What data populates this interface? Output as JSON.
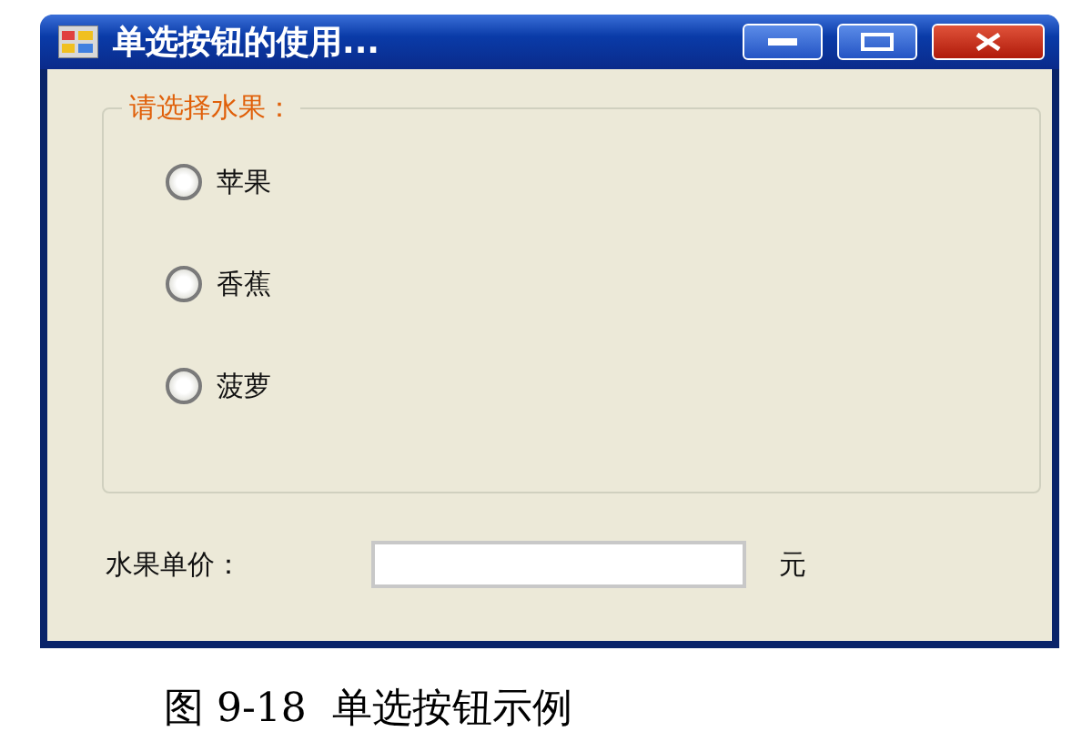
{
  "window": {
    "title": "单选按钮的使用..."
  },
  "group": {
    "legend": "请选择水果：",
    "options": [
      {
        "label": "苹果",
        "selected": false
      },
      {
        "label": "香蕉",
        "selected": false
      },
      {
        "label": "菠萝",
        "selected": false
      }
    ]
  },
  "price": {
    "label": "水果单价：",
    "unit": "元"
  },
  "caption": "图 9-18  单选按钮示例"
}
